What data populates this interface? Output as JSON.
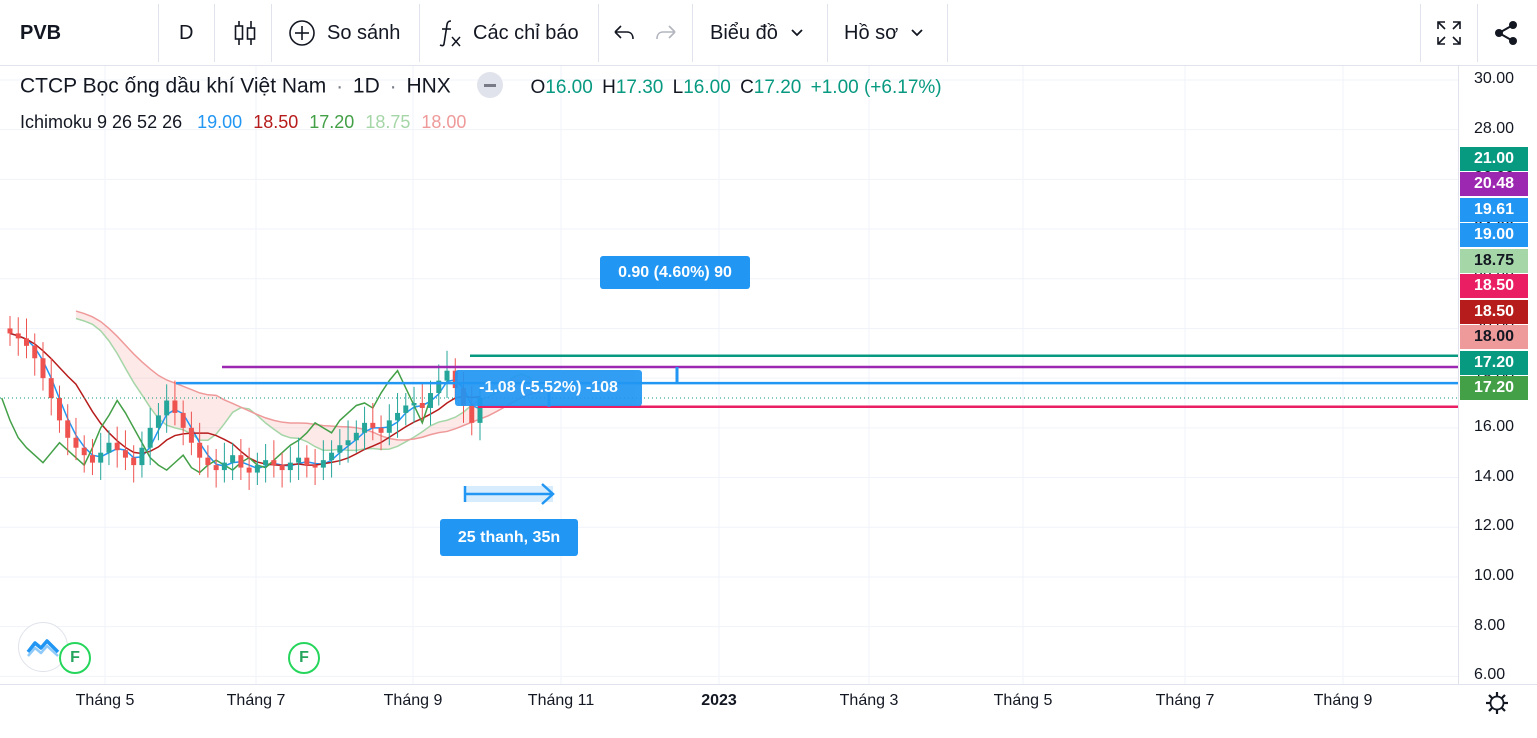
{
  "toolbar": {
    "symbol": "PVB",
    "interval": "D",
    "compare_label": "So sánh",
    "indicators_label": "Các chỉ báo",
    "chart_menu_label": "Biểu đồ",
    "profile_menu_label": "Hồ sơ",
    "icons": [
      "candles-icon",
      "plus-circle-icon",
      "fx-icon",
      "undo-icon",
      "redo-icon",
      "chevron-down-icon",
      "fullscreen-icon",
      "share-icon"
    ]
  },
  "legend": {
    "company": "CTCP Bọc ống dầu khí Việt Nam",
    "dot": "·",
    "interval": "1D",
    "exchange": "HNX",
    "o_label": "O",
    "o_value": "16.00",
    "h_label": "H",
    "h_value": "17.30",
    "l_label": "L",
    "l_value": "16.00",
    "c_label": "C",
    "c_value": "17.20",
    "change": "+1.00 (+6.17%)",
    "indicator_name": "Ichimoku 9 26 52 26",
    "ind_values": [
      "19.00",
      "18.50",
      "17.20",
      "18.75",
      "18.00"
    ]
  },
  "price_badges": [
    {
      "value": "21.00",
      "color": "#089981"
    },
    {
      "value": "20.48",
      "color": "#9c27b0"
    },
    {
      "value": "19.61",
      "color": "#2196f3"
    },
    {
      "value": "19.00",
      "color": "#2196f3"
    },
    {
      "value": "18.75",
      "color": "#a5d6a7",
      "text_color": "#131722"
    },
    {
      "value": "18.50",
      "color": "#e91e63"
    },
    {
      "value": "18.50",
      "color": "#b71c1c"
    },
    {
      "value": "18.00",
      "color": "#ef9a9a",
      "text_color": "#131722"
    },
    {
      "value": "17.20",
      "color": "#089981"
    },
    {
      "value": "17.20",
      "color": "#43a047"
    }
  ],
  "tooltips": {
    "measure_up": "0.90 (4.60%) 90",
    "measure_down": "-1.08 (-5.52%) -108",
    "bars_range": "25 thanh, 35n"
  },
  "markers": [
    "F",
    "F"
  ],
  "chart_data": {
    "type": "candlestick",
    "title": "CTCP Bọc ống dầu khí Việt Nam",
    "y_ticks": [
      "30.00",
      "28.00",
      "26.00",
      "24.00",
      "22.00",
      "20.00",
      "18.00",
      "16.00",
      "14.00",
      "12.00",
      "10.00",
      "8.00",
      "6.00"
    ],
    "x_ticks": [
      "Tháng 5",
      "Tháng 7",
      "Tháng 9",
      "Tháng 11",
      "2023",
      "Tháng 3",
      "Tháng 5",
      "Tháng 7",
      "Tháng 9"
    ],
    "ylim": [
      5.3,
      30.4
    ],
    "last_close": 17.2,
    "horizontal_lines": [
      {
        "name": "teal-line",
        "value": 18.9,
        "color": "#089981"
      },
      {
        "name": "purple-line",
        "value": 18.45,
        "color": "#9c27b0"
      },
      {
        "name": "blue-line",
        "value": 17.8,
        "color": "#2196f3"
      },
      {
        "name": "pink-line",
        "value": 16.85,
        "color": "#e91e63"
      }
    ],
    "close_series": [
      19.8,
      19.6,
      19.3,
      18.8,
      18.0,
      17.2,
      16.3,
      15.6,
      15.2,
      14.9,
      14.6,
      15.0,
      15.4,
      15.1,
      14.8,
      14.5,
      15.2,
      16.0,
      16.5,
      17.1,
      16.6,
      16.0,
      15.4,
      14.8,
      14.5,
      14.3,
      14.6,
      14.9,
      14.4,
      14.2,
      14.5,
      14.7,
      14.5,
      14.3,
      14.6,
      14.8,
      14.5,
      14.4,
      14.7,
      15.0,
      15.3,
      15.5,
      15.8,
      16.2,
      16.0,
      15.8,
      16.3,
      16.6,
      16.9,
      17.0,
      16.8,
      17.4,
      17.9,
      18.3,
      17.6,
      16.9,
      16.2,
      17.2
    ]
  }
}
